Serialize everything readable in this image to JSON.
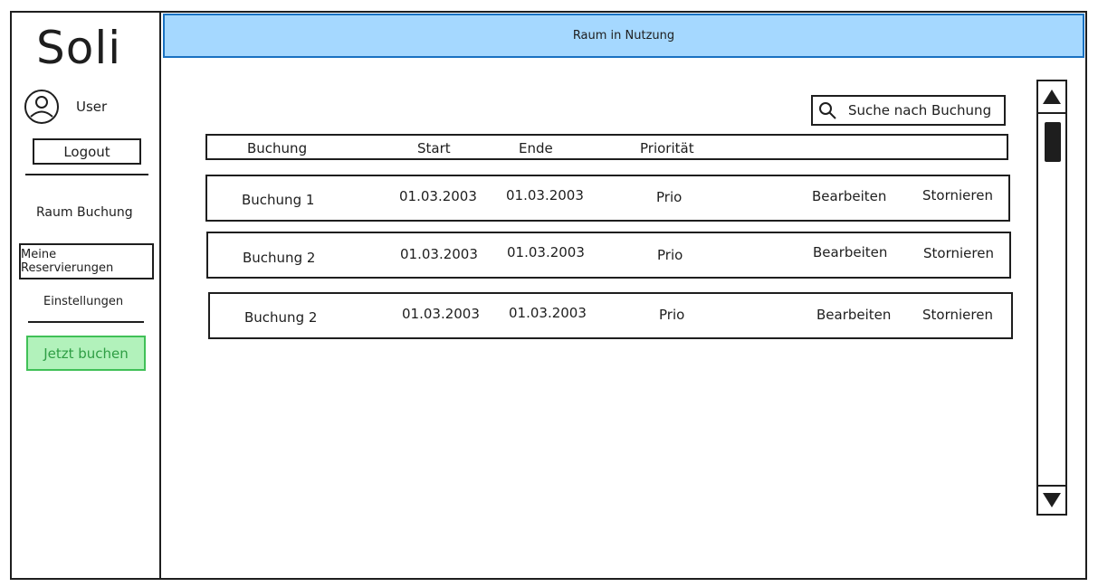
{
  "sidebar": {
    "logo": "Soli",
    "user_label": "User",
    "logout_label": "Logout",
    "nav": {
      "raum_buchung": "Raum Buchung",
      "meine_reservierungen": "Meine Reservierungen",
      "einstellungen": "Einstellungen"
    },
    "book_now_label": "Jetzt buchen"
  },
  "header": {
    "title": "Raum in Nutzung"
  },
  "search": {
    "placeholder": "Suche nach Buchung"
  },
  "table": {
    "columns": [
      "Buchung",
      "Start",
      "Ende",
      "Priorität"
    ],
    "rows": [
      {
        "name": "Buchung 1",
        "start": "01.03.2003",
        "end": "01.03.2003",
        "priority": "Prio",
        "edit": "Bearbeiten",
        "cancel": "Stornieren"
      },
      {
        "name": "Buchung 2",
        "start": "01.03.2003",
        "end": "01.03.2003",
        "priority": "Prio",
        "edit": "Bearbeiten",
        "cancel": "Stornieren"
      },
      {
        "name": "Buchung 2",
        "start": "01.03.2003",
        "end": "01.03.2003",
        "priority": "Prio",
        "edit": "Bearbeiten",
        "cancel": "Stornieren"
      }
    ]
  },
  "colors": {
    "header_fill": "#a5d8ff",
    "header_stroke": "#1971c2",
    "book_fill": "#b2f2bb",
    "book_stroke": "#40c057",
    "book_text": "#2f9e44"
  },
  "icons": {
    "avatar": "user-circle-icon",
    "search": "search-icon",
    "scroll_up": "triangle-up-icon",
    "scroll_down": "triangle-down-icon"
  }
}
